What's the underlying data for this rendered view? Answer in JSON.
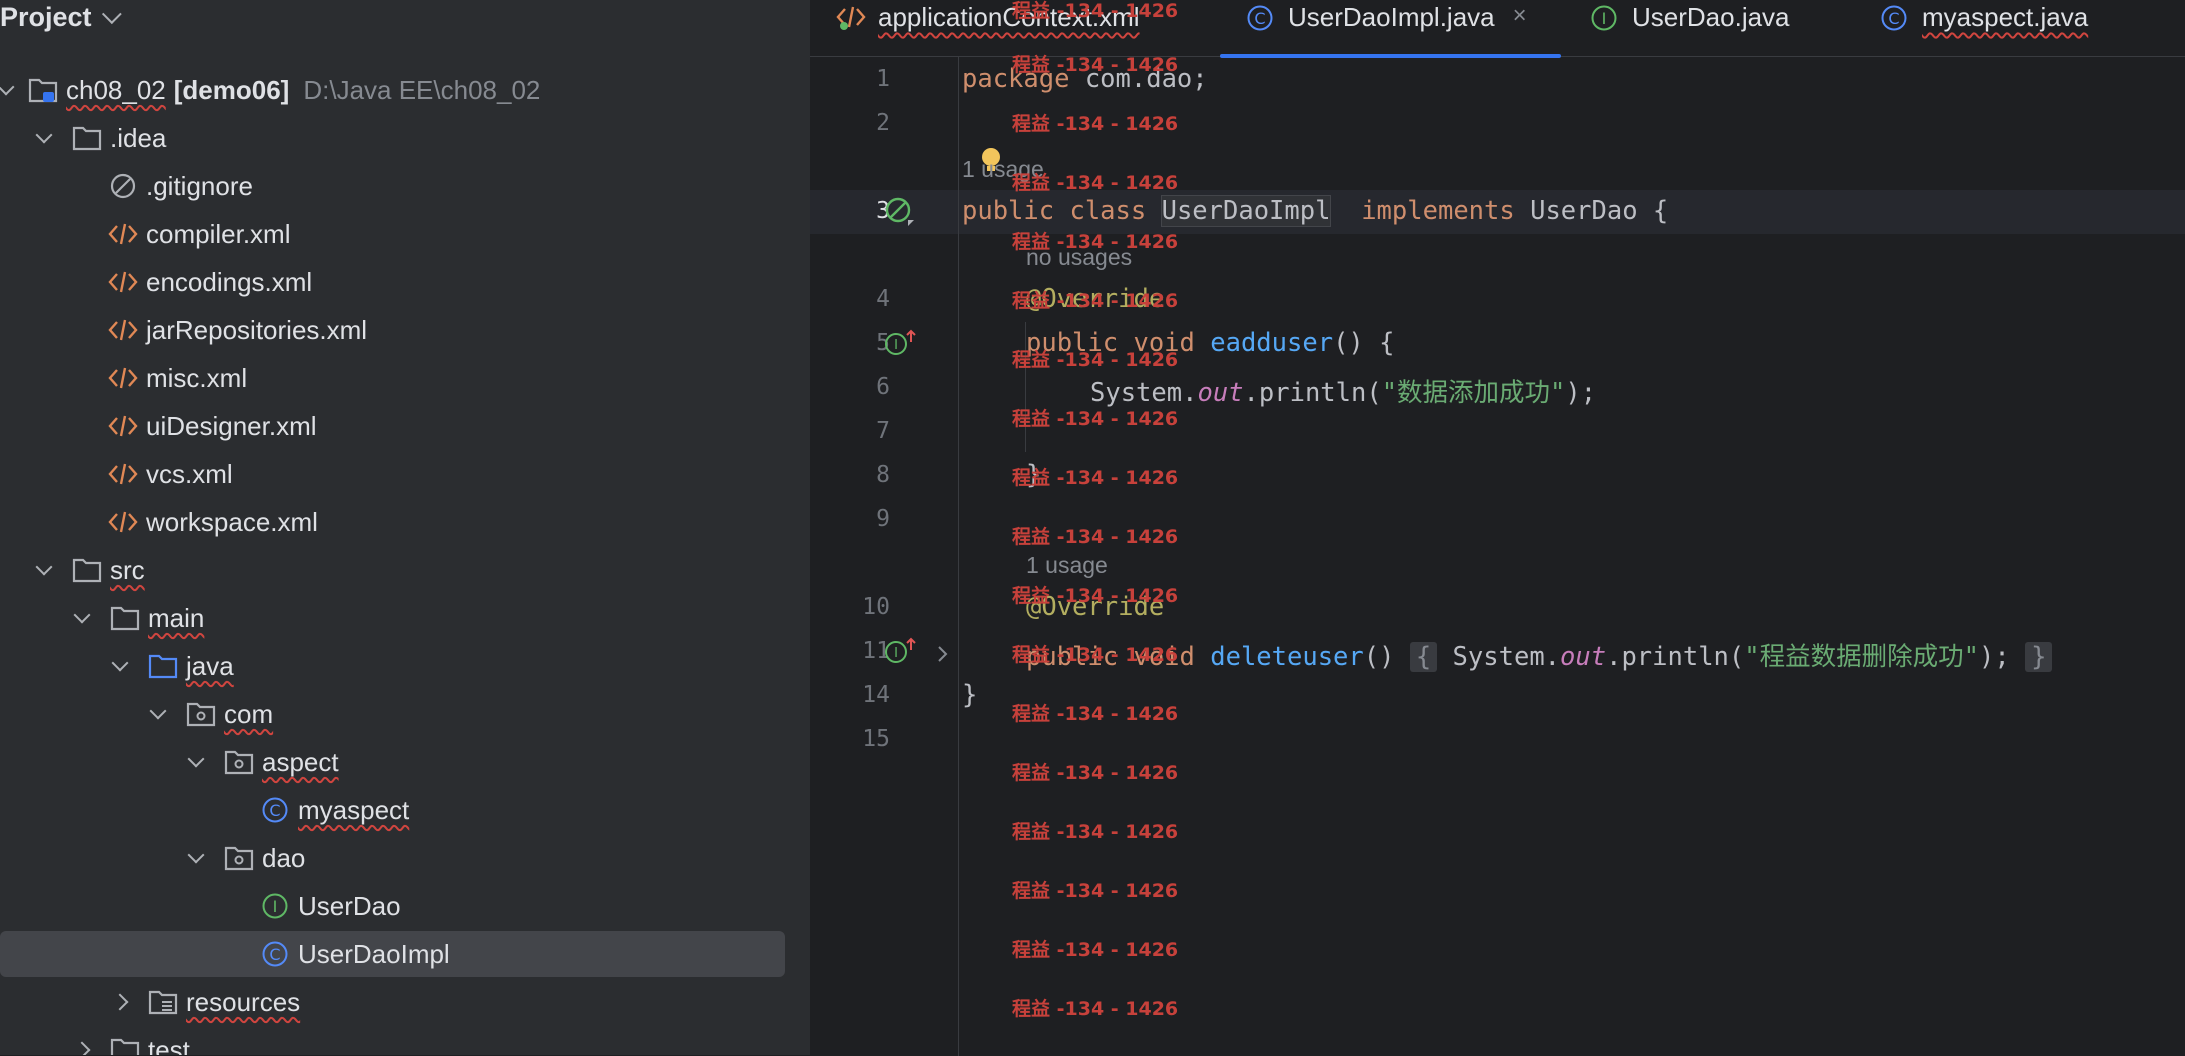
{
  "sidebar": {
    "title": "Project",
    "items": [
      {
        "label": "ch08_02",
        "module": "[demo06]",
        "path": "D:\\Java EE\\ch08_02",
        "icon": "module-folder-icon"
      },
      {
        "label": ".idea",
        "icon": "folder-icon"
      },
      {
        "label": ".gitignore",
        "icon": "ignore-file-icon"
      },
      {
        "label": "compiler.xml",
        "icon": "xml-file-icon"
      },
      {
        "label": "encodings.xml",
        "icon": "xml-file-icon"
      },
      {
        "label": "jarRepositories.xml",
        "icon": "xml-file-icon"
      },
      {
        "label": "misc.xml",
        "icon": "xml-file-icon"
      },
      {
        "label": "uiDesigner.xml",
        "icon": "xml-file-icon"
      },
      {
        "label": "vcs.xml",
        "icon": "xml-file-icon"
      },
      {
        "label": "workspace.xml",
        "icon": "xml-file-icon"
      },
      {
        "label": "src",
        "icon": "folder-icon"
      },
      {
        "label": "main",
        "icon": "folder-icon"
      },
      {
        "label": "java",
        "icon": "source-folder-icon"
      },
      {
        "label": "com",
        "icon": "package-icon"
      },
      {
        "label": "aspect",
        "icon": "package-icon"
      },
      {
        "label": "myaspect",
        "icon": "class-icon"
      },
      {
        "label": "dao",
        "icon": "package-icon"
      },
      {
        "label": "UserDao",
        "icon": "interface-icon"
      },
      {
        "label": "UserDaoImpl",
        "icon": "class-icon"
      },
      {
        "label": "resources",
        "icon": "resources-folder-icon"
      },
      {
        "label": "test",
        "icon": "folder-icon"
      }
    ]
  },
  "tabs": [
    {
      "label": "applicationContext.xml",
      "icon": "xml-file-icon"
    },
    {
      "label": "UserDaoImpl.java",
      "icon": "class-icon",
      "close": "×"
    },
    {
      "label": "UserDao.java",
      "icon": "interface-icon"
    },
    {
      "label": "myaspect.java",
      "icon": "class-icon"
    }
  ],
  "editor": {
    "line_numbers": [
      "1",
      "2",
      "3",
      "4",
      "5",
      "6",
      "7",
      "8",
      "9",
      "10",
      "11",
      "14",
      "15"
    ],
    "hints": {
      "usage1": "1 usage",
      "no_usages": "no usages",
      "usage2": "1 usage"
    },
    "code": {
      "l1_kw": "package",
      "l1_rest": " com.dao;",
      "l3_kw": "public class ",
      "l3_name": "UserDaoImpl",
      "l3_impl": "implements",
      "l3_rest": " UserDao {",
      "l4_ann": "@Override",
      "l5_kw": "public void ",
      "l5_fn": "eadduser",
      "l5_rest": "() {",
      "l6_pre": "System.",
      "l6_fld": "out",
      "l6_mid": ".println(",
      "l6_str": "\"数据添加成功\"",
      "l6_end": ");",
      "l8": "}",
      "l10_ann": "@Override",
      "l11_kw": "public void ",
      "l11_fn": "deleteuser",
      "l11_paren": "()",
      "l11_open": "{",
      "l11_pre": " System.",
      "l11_fld": "out",
      "l11_mid": ".println(",
      "l11_str": "\"程益数据删除成功\"",
      "l11_end": ");",
      "l11_close": "}",
      "l14": "}"
    }
  },
  "watermark": "程益 -134 - 1426",
  "colors": {
    "accent": "#3574f0",
    "keyword": "#cf8e6d",
    "string": "#6aab73",
    "function": "#56a8f5",
    "annotation": "#b3ae60",
    "watermark": "#c7413b"
  }
}
